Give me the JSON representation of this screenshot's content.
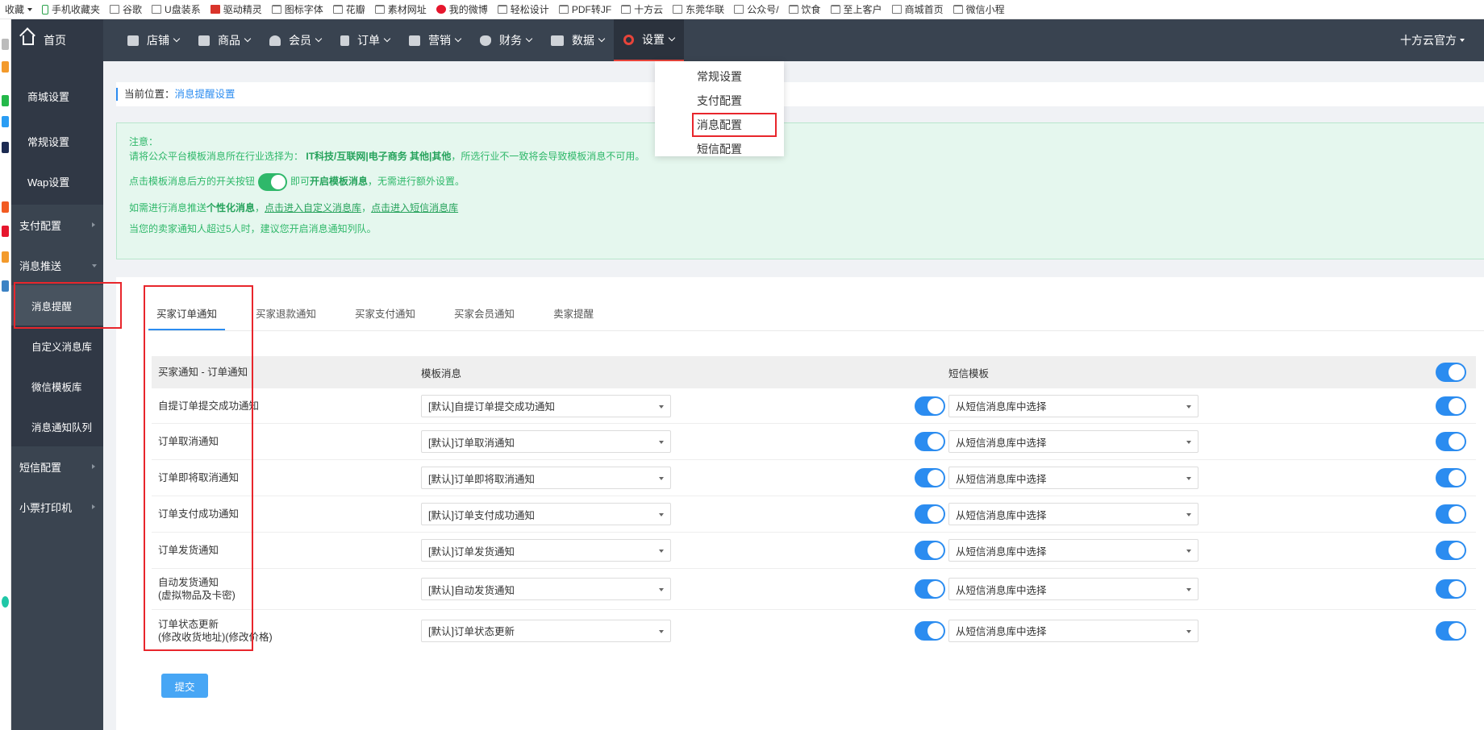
{
  "bookmarks": [
    {
      "label": "收藏",
      "icon": "none"
    },
    {
      "label": "手机收藏夹",
      "icon": "phone"
    },
    {
      "label": "谷歌",
      "icon": "page"
    },
    {
      "label": "U盘装系",
      "icon": "page"
    },
    {
      "label": "驱动精灵",
      "icon": "red"
    },
    {
      "label": "图标字体",
      "icon": "folder"
    },
    {
      "label": "花瓣",
      "icon": "folder"
    },
    {
      "label": "素材网址",
      "icon": "folder"
    },
    {
      "label": "我的微博",
      "icon": "weibo"
    },
    {
      "label": "轻松设计",
      "icon": "folder"
    },
    {
      "label": "PDF转JF",
      "icon": "folder"
    },
    {
      "label": "十方云",
      "icon": "folder"
    },
    {
      "label": "东莞华联",
      "icon": "page"
    },
    {
      "label": "公众号/",
      "icon": "page"
    },
    {
      "label": "饮食",
      "icon": "folder"
    },
    {
      "label": "至上客户",
      "icon": "folder"
    },
    {
      "label": "商城首页",
      "icon": "page"
    },
    {
      "label": "微信小程",
      "icon": "folder"
    }
  ],
  "topnav": {
    "home": "首页",
    "items": [
      {
        "label": "店铺",
        "icon": "store-icon"
      },
      {
        "label": "商品",
        "icon": "goods-icon"
      },
      {
        "label": "会员",
        "icon": "user-icon"
      },
      {
        "label": "订单",
        "icon": "document-icon"
      },
      {
        "label": "营销",
        "icon": "gift-icon"
      },
      {
        "label": "财务",
        "icon": "money-bag-icon"
      },
      {
        "label": "数据",
        "icon": "chart-icon"
      },
      {
        "label": "设置",
        "icon": "gear-icon",
        "active": true
      }
    ],
    "user": "十方云官方"
  },
  "dropdown": [
    "常规设置",
    "支付配置",
    "消息配置",
    "短信配置"
  ],
  "sidebar": {
    "top": [
      "商城设置",
      "常规设置",
      "Wap设置"
    ],
    "pay": "支付配置",
    "msg": "消息推送",
    "msg_children": [
      "消息提醒",
      "自定义消息库",
      "微信模板库",
      "消息通知队列"
    ],
    "sms": "短信配置",
    "printer": "小票打印机"
  },
  "breadcrumb": {
    "prefix": "当前位置：",
    "current": "消息提醒设置"
  },
  "notice": {
    "title": "注意：",
    "line1_a": "请将公众平台模板消息所在行业选择为：",
    "line1_b": "IT科技/互联网|电子商务 其他|其他",
    "line1_c": "，所选行业不一致将会导致模板消息不可用。",
    "line2_a": "点击模板消息后方的开关按钮",
    "line2_b": "即可",
    "line2_c": "开启模板消息",
    "line2_d": "，无需进行额外设置。",
    "line3_a": "如需进行消息推送",
    "line3_b": "个性化消息",
    "line3_c": "，",
    "line3_d": "点击进入自定义消息库",
    "line3_e": "，",
    "line3_f": "点击进入短信消息库",
    "line4": "当您的卖家通知人超过5人时，建议您开启消息通知列队。"
  },
  "tabs": [
    "买家订单通知",
    "买家退款通知",
    "买家支付通知",
    "买家会员通知",
    "卖家提醒"
  ],
  "table": {
    "headers": [
      "买家通知 - 订单通知",
      "模板消息",
      "短信模板"
    ],
    "rows": [
      {
        "name": "自提订单提交成功通知",
        "name2": "",
        "template": "[默认]自提订单提交成功通知",
        "sms": "从短信消息库中选择"
      },
      {
        "name": "订单取消通知",
        "name2": "",
        "template": "[默认]订单取消通知",
        "sms": "从短信消息库中选择"
      },
      {
        "name": "订单即将取消通知",
        "name2": "",
        "template": "[默认]订单即将取消通知",
        "sms": "从短信消息库中选择"
      },
      {
        "name": "订单支付成功通知",
        "name2": "",
        "template": "[默认]订单支付成功通知",
        "sms": "从短信消息库中选择"
      },
      {
        "name": "订单发货通知",
        "name2": "",
        "template": "[默认]订单发货通知",
        "sms": "从短信消息库中选择"
      },
      {
        "name": "自动发货通知",
        "name2": "(虚拟物品及卡密)",
        "template": "[默认]自动发货通知",
        "sms": "从短信消息库中选择"
      },
      {
        "name": "订单状态更新",
        "name2": "(修改收货地址)(修改价格)",
        "template": "[默认]订单状态更新",
        "sms": "从短信消息库中选择"
      }
    ]
  },
  "submit": "提交",
  "colors": {
    "nav_bg": "#394350",
    "sidebar_bg": "#3a4450",
    "accent_blue": "#2b8cf0",
    "switch_blue": "#2b8cf0",
    "notice_green": "#2fb86a",
    "highlight_red": "#e8262c"
  }
}
